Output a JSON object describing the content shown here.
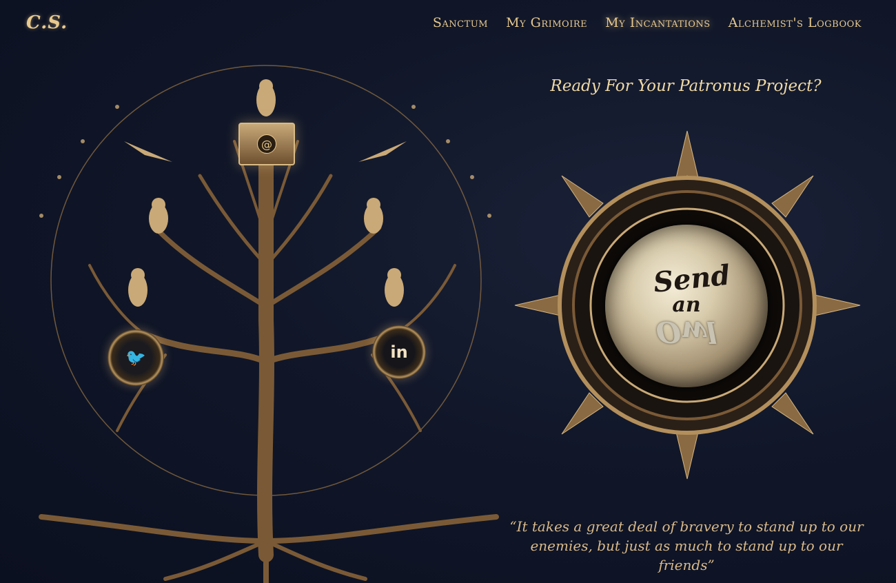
{
  "brand": {
    "logo_text": "C.S."
  },
  "nav": {
    "items": [
      {
        "label": "Sanctum",
        "active": false
      },
      {
        "label": "My Grimoire",
        "active": false
      },
      {
        "label": "My Incantations",
        "active": true
      },
      {
        "label": "Alchemist's Logbook",
        "active": false
      }
    ]
  },
  "contact": {
    "email_icon": "envelope-at-icon",
    "email_glyph": "@",
    "twitter_icon": "twitter-bird-icon",
    "twitter_glyph": "🐦",
    "linkedin_icon": "linkedin-icon",
    "linkedin_glyph": "in"
  },
  "main": {
    "headline": "Ready For Your Patronus Project?",
    "cta": {
      "line1": "Send",
      "line2": "an",
      "line3": "Owl"
    },
    "quote": "“It takes a great deal of bravery to stand up to our enemies, but just as much to stand up to our friends”"
  },
  "colors": {
    "background": "#111729",
    "gold": "#e8c98e",
    "bronze": "#8a6a42"
  }
}
